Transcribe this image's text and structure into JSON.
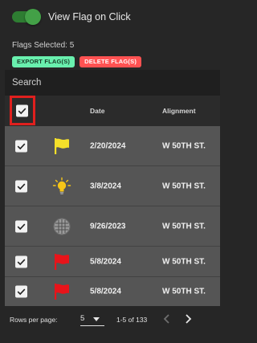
{
  "toggle": {
    "label": "View Flag on Click",
    "on": true
  },
  "selection": {
    "text": "Flags Selected: 5"
  },
  "buttons": {
    "export": "EXPORT FLAG(S)",
    "delete": "DELETE FLAG(S)"
  },
  "search": {
    "placeholder": "Search"
  },
  "table": {
    "headers": {
      "date": "Date",
      "alignment": "Alignment"
    },
    "rows": [
      {
        "icon": "yellow-flag-icon",
        "date": "2/20/2024",
        "alignment": "W 50TH ST."
      },
      {
        "icon": "lightbulb-icon",
        "date": "3/8/2024",
        "alignment": "W 50TH ST."
      },
      {
        "icon": "grate-icon",
        "date": "9/26/2023",
        "alignment": "W 50TH ST."
      },
      {
        "icon": "red-flag-icon",
        "date": "5/8/2024",
        "alignment": "W 50TH ST."
      },
      {
        "icon": "red-flag-icon",
        "date": "5/8/2024",
        "alignment": "W 50TH ST."
      }
    ]
  },
  "pagination": {
    "rows_per_page_label": "Rows per page:",
    "rows_per_page_value": "5",
    "range": "1-5 of 133"
  },
  "colors": {
    "toggle_on": "#43a047",
    "export_button": "#69f0ae",
    "delete_button": "#ff5252",
    "header_highlight": "#e0201e",
    "flag_yellow": "#f5e02a",
    "flag_red": "#e8141a"
  }
}
